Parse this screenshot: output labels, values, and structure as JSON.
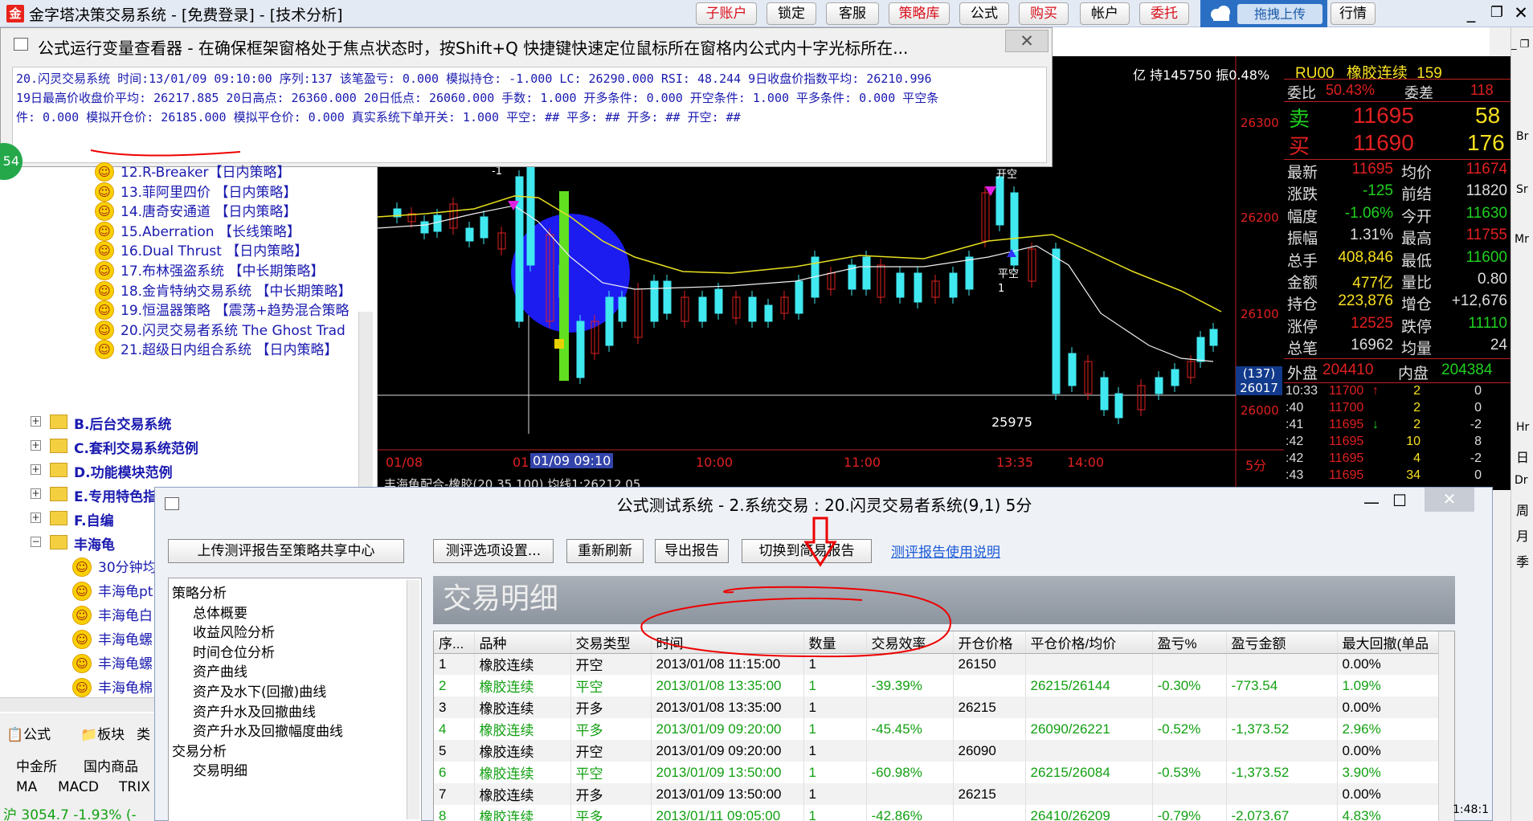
{
  "app": {
    "title": "金字塔决策交易系统 - [免费登录] - [技术分析]",
    "logo": "金",
    "toolbar": [
      "子账户",
      "锁定",
      "客服",
      "策略库",
      "公式",
      "购买",
      "帐户",
      "委托"
    ],
    "cloud_upload": "拖拽上传",
    "market_btn": "行情"
  },
  "var_viewer": {
    "title": "公式运行变量查看器 - 在确保框架窗格处于焦点状态时，按Shift+Q 快捷键快速定位鼠标所在窗格内公式内十字光标所在...",
    "close": "✕",
    "lines": [
      "20.闪灵交易系统 时间:13/01/09 09:10:00 序列:137  该笔盈亏: 0.000 模拟持仓: -1.000 LC: 26290.000 RSI: 48.244 9日收盘价指数平均: 26210.996",
      "19日最高价收盘价平均: 26217.885 20日高点: 26360.000 20日低点: 26060.000 手数: 1.000 开多条件: 0.000 开空条件: 1.000 平多条件: 0.000 平空条",
      "件: 0.000 模拟开仓价: 26185.000 模拟平仓价: 0.000 真实系统下单开关: 1.000 平空: ## 平多: ## 开多: ## 开空: ##"
    ]
  },
  "badge": "54",
  "tree": {
    "strategies": [
      "12.R-Breaker【日内策略】",
      "13.菲阿里四价 【日内策略】",
      "14.唐奇安通道 【日内策略】",
      "15.Aberration 【长线策略】",
      "16.Dual Thrust 【日内策略】",
      "17.布林强盗系统 【中长期策略】",
      "18.金肯特纳交易系统 【中长期策略】",
      "19.恒温器策略 【震荡+趋势混合策略",
      "20.闪灵交易者系统 The Ghost Trad",
      "21.超级日内组合系统 【日内策略】"
    ],
    "groups": [
      "B.后台交易系统",
      "C.套利交易系统范例",
      "D.功能模块范例",
      "E.专用特色指标",
      "F.自编",
      "丰海龟"
    ],
    "sub_items": [
      "30分钟均",
      "丰海龟pt",
      "丰海龟白",
      "丰海龟螺",
      "丰海龟螺",
      "丰海龟棉"
    ]
  },
  "bottom_tabs": {
    "tabs": [
      "公式",
      "板块",
      "类"
    ],
    "markets": [
      "中金所",
      "国内商品"
    ],
    "indicators": [
      "MA",
      "MACD",
      "TRIX"
    ],
    "index_line": "沪 3054.7 -1.93% (-"
  },
  "chart": {
    "header_fragment": "亿 持145750 振0.48%",
    "price_labels": [
      "26300",
      "26200",
      "26100",
      "26000"
    ],
    "current_price": "26017",
    "current_count": "(137)",
    "time_labels": [
      "01/08",
      "01",
      "01/09 09:10",
      "10:00",
      "11:00",
      "13:35",
      "14:00",
      "5分"
    ],
    "status_text": "丰海龟配合-橡胶(20,35,100) 均线1:26212.05",
    "low_label": "25975",
    "open_short_label": "开空",
    "close_short_label": "平空",
    "marker_num": "1",
    "top_marker": "-1",
    "top_marker2": "开空"
  },
  "quote": {
    "code": "RU00",
    "name": "橡胶连续",
    "num": "159",
    "wb_label": "委比",
    "wb": "50.43%",
    "wc_label": "委差",
    "wc": "118",
    "sell_label": "卖",
    "sell_price": "11695",
    "sell_vol": "58",
    "buy_label": "买",
    "buy_price": "11690",
    "buy_vol": "176",
    "rows": [
      [
        "最新",
        "11695",
        "均价",
        "11674"
      ],
      [
        "涨跌",
        "-125",
        "前结",
        "11820"
      ],
      [
        "幅度",
        "-1.06%",
        "今开",
        "11630"
      ],
      [
        "振幅",
        "1.31%",
        "最高",
        "11755"
      ],
      [
        "总手",
        "408,846",
        "最低",
        "11600"
      ],
      [
        "金额",
        "477亿",
        "量比",
        "0.80"
      ],
      [
        "持仓",
        "223,876",
        "增仓",
        "+12,676"
      ],
      [
        "涨停",
        "12525",
        "跌停",
        "11110"
      ],
      [
        "总笔",
        "16962",
        "均量",
        "24"
      ]
    ],
    "outer_label": "外盘",
    "outer": "204410",
    "inner_label": "内盘",
    "inner": "204384",
    "ticks": [
      [
        "10:33",
        "11700",
        "↑",
        "2",
        "0"
      ],
      [
        ":40",
        "11700",
        "",
        "2",
        "0"
      ],
      [
        ":41",
        "11695",
        "↓",
        "2",
        "-2"
      ],
      [
        ":42",
        "11695",
        "",
        "10",
        "8"
      ],
      [
        ":42",
        "11695",
        "",
        "4",
        "-2"
      ],
      [
        ":43",
        "11695",
        "",
        "34",
        "0"
      ]
    ]
  },
  "test_window": {
    "title": "公式测试系统 - 2.系统交易 : 20.闪灵交易者系统(9,1) 5分",
    "buttons": [
      "上传测评报告至策略共享中心",
      "测评选项设置...",
      "重新刷新",
      "导出报告",
      "切换到简易报告"
    ],
    "help_link": "测评报告使用说明",
    "nav": [
      "策略分析",
      "总体概要",
      "收益风险分析",
      "时间仓位分析",
      "资产曲线",
      "资产及水下(回撤)曲线",
      "资产升水及回撤曲线",
      "资产升水及回撤幅度曲线",
      "交易分析",
      "交易明细"
    ],
    "detail_header": "交易明细",
    "columns": [
      "序...",
      "品种",
      "交易类型",
      "时间",
      "数量",
      "交易效率",
      "开仓价格",
      "平仓价格/均价",
      "盈亏%",
      "盈亏金额",
      "最大回撤(单品"
    ],
    "rows": [
      [
        "1",
        "橡胶连续",
        "开空",
        "2013/01/08 11:15:00",
        "1",
        "",
        "26150",
        "",
        "",
        "",
        "0.00%"
      ],
      [
        "2",
        "橡胶连续",
        "平空",
        "2013/01/08 13:35:00",
        "1",
        "-39.39%",
        "",
        "26215/26144",
        "-0.30%",
        "-773.54",
        "1.09%"
      ],
      [
        "3",
        "橡胶连续",
        "开多",
        "2013/01/08 13:35:00",
        "1",
        "",
        "26215",
        "",
        "",
        "",
        "0.00%"
      ],
      [
        "4",
        "橡胶连续",
        "平多",
        "2013/01/09 09:20:00",
        "1",
        "-45.45%",
        "",
        "26090/26221",
        "-0.52%",
        "-1,373.52",
        "2.96%"
      ],
      [
        "5",
        "橡胶连续",
        "开空",
        "2013/01/09 09:20:00",
        "1",
        "",
        "26090",
        "",
        "",
        "",
        "0.00%"
      ],
      [
        "6",
        "橡胶连续",
        "平空",
        "2013/01/09 13:50:00",
        "1",
        "-60.98%",
        "",
        "26215/26084",
        "-0.53%",
        "-1,373.52",
        "3.90%"
      ],
      [
        "7",
        "橡胶连续",
        "开多",
        "2013/01/09 13:50:00",
        "1",
        "",
        "26215",
        "",
        "",
        "",
        "0.00%"
      ],
      [
        "8",
        "橡胶连续",
        "平多",
        "2013/01/11 09:05:00",
        "1",
        "-42.86%",
        "",
        "26410/26209",
        "-0.79%",
        "-2,073.67",
        "4.83%"
      ]
    ]
  },
  "right_strip": [
    "Br",
    "Sr",
    "Mr",
    "Hr",
    "日",
    "Dr",
    "周",
    "月",
    "季"
  ],
  "clock": "1:48:1"
}
